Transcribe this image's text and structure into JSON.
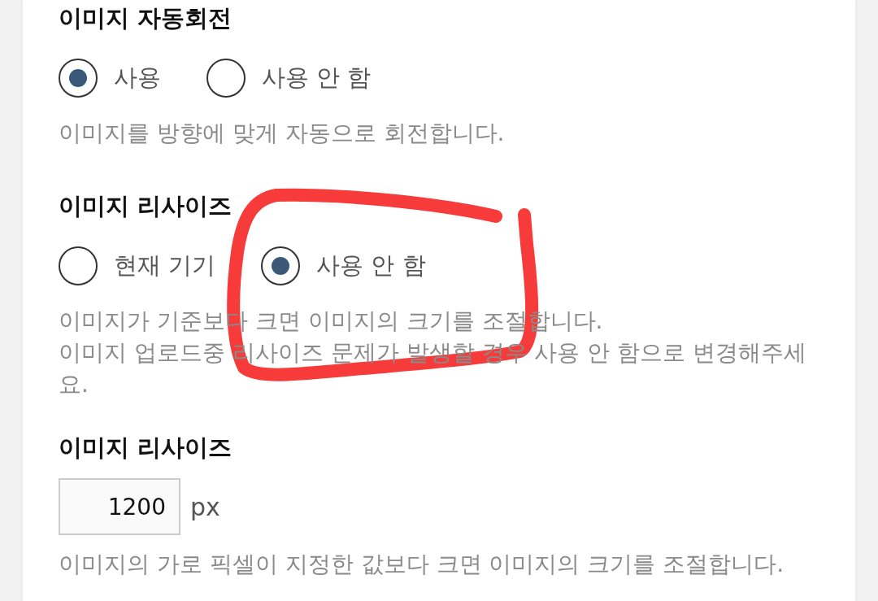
{
  "sections": [
    {
      "title": "이미지 자동회전",
      "options": [
        {
          "label": "사용",
          "selected": true
        },
        {
          "label": "사용 안 함",
          "selected": false
        }
      ],
      "description": [
        "이미지를 방향에 맞게 자동으로 회전합니다."
      ]
    },
    {
      "title": "이미지 리사이즈",
      "options": [
        {
          "label": "현재 기기",
          "selected": false
        },
        {
          "label": "사용 안 함",
          "selected": true
        }
      ],
      "description": [
        "이미지가 기준보다 크면 이미지의 크기를 조절합니다.",
        "이미지 업로드중 리사이즈 문제가 발생할 경우 사용 안 함으로 변경해주세요."
      ]
    },
    {
      "title": "이미지 리사이즈",
      "input": {
        "value": "1200",
        "unit": "px"
      },
      "description": [
        "이미지의 가로 픽셀이 지정한 값보다 크면 이미지의 크기를 조절합니다."
      ]
    }
  ],
  "annotation": {
    "kind": "scribble",
    "color": "#f73b3b"
  }
}
